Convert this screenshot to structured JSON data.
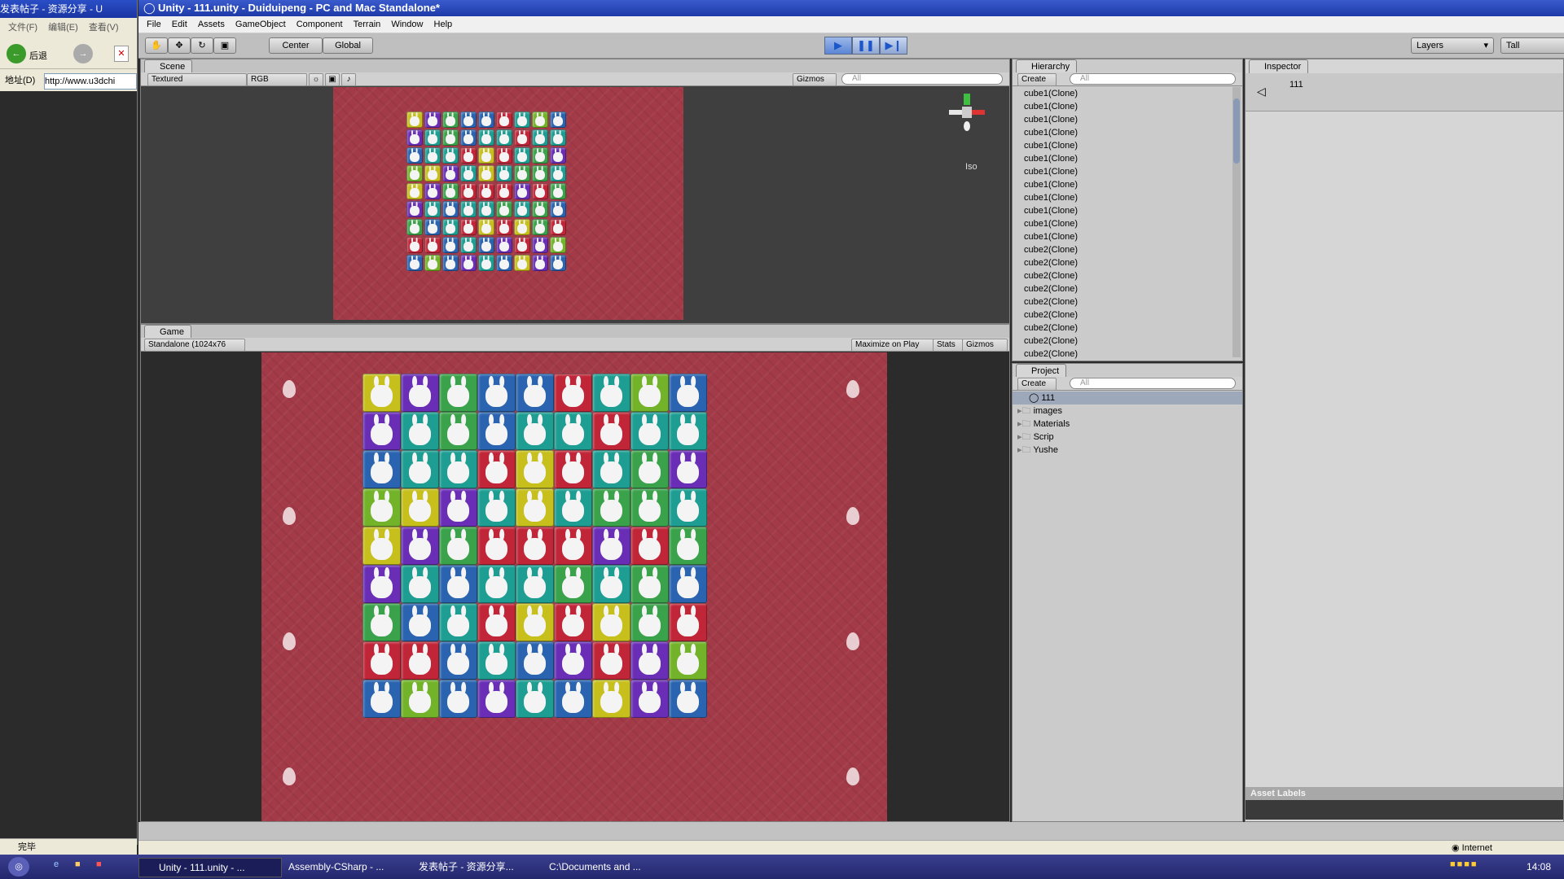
{
  "ie": {
    "title": "发表帖子 - 资源分享 - U",
    "menu": [
      "文件(F)",
      "编辑(E)",
      "查看(V)"
    ],
    "back_label": "后退",
    "address_label": "地址(D)",
    "address_value": "http://www.u3dchi",
    "status": "完毕"
  },
  "unity": {
    "title": "Unity - 111.unity - Duiduipeng - PC and Mac Standalone*",
    "menu": [
      "File",
      "Edit",
      "Assets",
      "GameObject",
      "Component",
      "Terrain",
      "Window",
      "Help"
    ],
    "toolbar": {
      "pivot": "Center",
      "space": "Global",
      "layers": "Layers",
      "layout": "Tall"
    },
    "scene": {
      "tab": "Scene",
      "render_mode": "Textured",
      "color_mode": "RGB",
      "gizmos": "Gizmos",
      "search_placeholder": "All",
      "iso": "Iso"
    },
    "game": {
      "tab": "Game",
      "resolution": "Standalone (1024x76",
      "maximize": "Maximize on Play",
      "stats": "Stats",
      "gizmos": "Gizmos"
    },
    "hierarchy": {
      "tab": "Hierarchy",
      "create": "Create",
      "search_placeholder": "All",
      "items": [
        "cube1(Clone)",
        "cube1(Clone)",
        "cube1(Clone)",
        "cube1(Clone)",
        "cube1(Clone)",
        "cube1(Clone)",
        "cube1(Clone)",
        "cube1(Clone)",
        "cube1(Clone)",
        "cube1(Clone)",
        "cube1(Clone)",
        "cube1(Clone)",
        "cube2(Clone)",
        "cube2(Clone)",
        "cube2(Clone)",
        "cube2(Clone)",
        "cube2(Clone)",
        "cube2(Clone)",
        "cube2(Clone)",
        "cube2(Clone)",
        "cube2(Clone)",
        "cube2(Clone)"
      ]
    },
    "project": {
      "tab": "Project",
      "create": "Create",
      "search_placeholder": "All",
      "items": [
        "111",
        "images",
        "Materials",
        "Scrip",
        "Yushe"
      ]
    },
    "inspector": {
      "tab": "Inspector",
      "selected": "111",
      "asset_labels": "Asset Labels"
    }
  },
  "board": {
    "rows": [
      [
        "y",
        "p",
        "g",
        "b",
        "b",
        "r",
        "t",
        "l",
        "b"
      ],
      [
        "p",
        "t",
        "g",
        "b",
        "t",
        "t",
        "r",
        "t",
        "t"
      ],
      [
        "b",
        "t",
        "t",
        "r",
        "y",
        "r",
        "t",
        "g",
        "p"
      ],
      [
        "l",
        "y",
        "p",
        "t",
        "y",
        "t",
        "g",
        "g",
        "t"
      ],
      [
        "y",
        "p",
        "g",
        "r",
        "r",
        "r",
        "p",
        "r",
        "g"
      ],
      [
        "p",
        "t",
        "b",
        "t",
        "t",
        "g",
        "t",
        "g",
        "b"
      ],
      [
        "g",
        "b",
        "t",
        "r",
        "y",
        "r",
        "y",
        "g",
        "r"
      ],
      [
        "r",
        "r",
        "b",
        "t",
        "b",
        "p",
        "r",
        "p",
        "l"
      ],
      [
        "b",
        "l",
        "b",
        "p",
        "t",
        "b",
        "y",
        "p",
        "b"
      ]
    ],
    "colors": {
      "y": "#c6bf1c",
      "p": "#6a2eb6",
      "g": "#3aa24a",
      "b": "#2a64b0",
      "t": "#1e9e92",
      "r": "#c02638",
      "l": "#73b32a"
    }
  },
  "taskbar": {
    "items": [
      "Unity - 111.unity - ...",
      "Assembly-CSharp - ...",
      "发表帖子 - 资源分享...",
      "C:\\Documents and ..."
    ],
    "zone": "Internet",
    "clock": "14:08"
  }
}
